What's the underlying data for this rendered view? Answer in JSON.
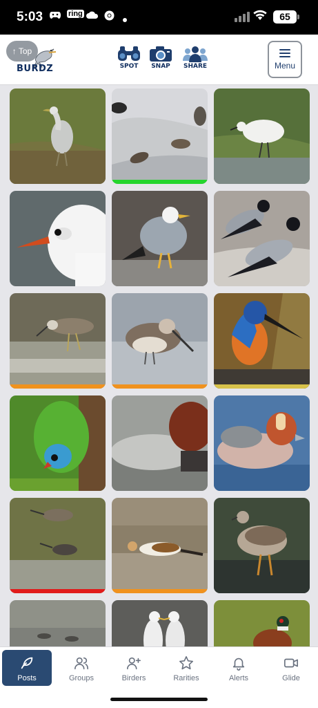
{
  "status_bar": {
    "time": "5:03",
    "battery": "65",
    "app_icons": [
      "game-controller-icon",
      "ring-icon",
      "cloud-icon",
      "chrome-icon",
      "dot-icon"
    ]
  },
  "header": {
    "logo_text": "BURDZ",
    "top_button": "↑ Top",
    "nav": [
      {
        "label": "SPOT",
        "icon": "binoculars-icon"
      },
      {
        "label": "SNAP",
        "icon": "camera-icon"
      },
      {
        "label": "SHARE",
        "icon": "people-icon"
      }
    ],
    "menu_label": "Menu"
  },
  "grid": {
    "tiles": [
      {
        "subject": "grey heron",
        "bar": null
      },
      {
        "subject": "sparrows on roof",
        "bar": "#25d52d"
      },
      {
        "subject": "little egret",
        "bar": null
      },
      {
        "subject": "black-headed gull",
        "bar": null
      },
      {
        "subject": "herring gull",
        "bar": null
      },
      {
        "subject": "hooded crows",
        "bar": null
      },
      {
        "subject": "greenshank",
        "bar": "#f0921e"
      },
      {
        "subject": "dowitcher",
        "bar": "#f0921e"
      },
      {
        "subject": "kingfisher",
        "bar": "#d8c24a"
      },
      {
        "subject": "parakeet",
        "bar": null
      },
      {
        "subject": "pochard",
        "bar": null
      },
      {
        "subject": "wigeon",
        "bar": null
      },
      {
        "subject": "godwits",
        "bar": "#e11b1b"
      },
      {
        "subject": "snow bunting",
        "bar": "#f0921e"
      },
      {
        "subject": "ruff",
        "bar": null
      },
      {
        "subject": "waders",
        "bar": null
      },
      {
        "subject": "gulls",
        "bar": null
      },
      {
        "subject": "pheasant",
        "bar": null
      }
    ]
  },
  "bottom_nav": {
    "tabs": [
      {
        "label": "Posts",
        "icon": "feather-icon",
        "active": true
      },
      {
        "label": "Groups",
        "icon": "users-icon",
        "active": false
      },
      {
        "label": "Birders",
        "icon": "user-plus-icon",
        "active": false
      },
      {
        "label": "Rarities",
        "icon": "star-icon",
        "active": false
      },
      {
        "label": "Alerts",
        "icon": "bell-icon",
        "active": false
      },
      {
        "label": "Glide",
        "icon": "video-icon",
        "active": false
      }
    ]
  }
}
